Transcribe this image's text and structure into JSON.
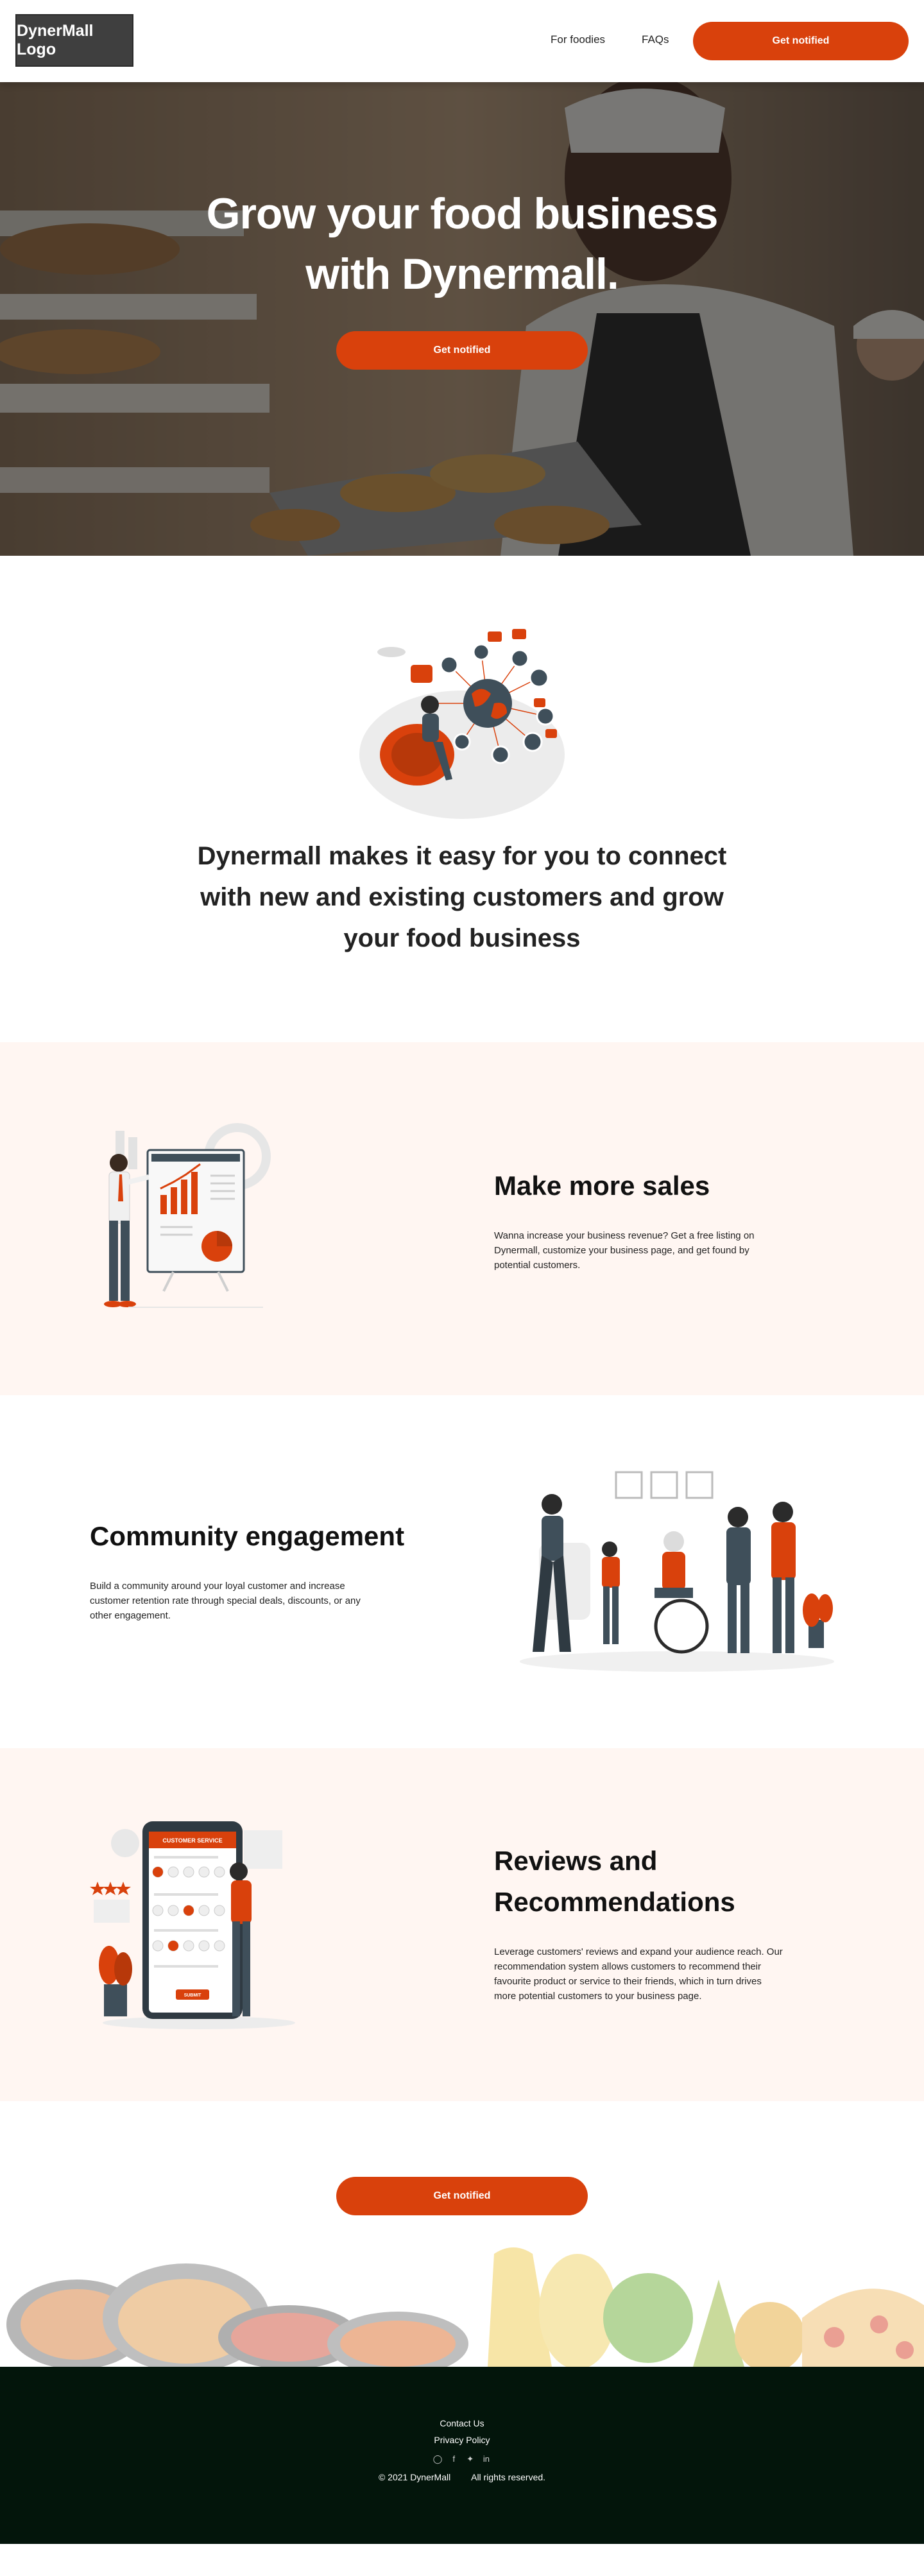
{
  "nav": {
    "logo": "DynerMall Logo",
    "links": [
      "For foodies",
      "FAQs"
    ],
    "cta": "Get notified"
  },
  "hero": {
    "title_line1": "Grow your food business",
    "title_line2": "with Dynermall.",
    "cta": "Get notified"
  },
  "intro": {
    "text": "Dynermall makes it easy for you to connect with new and existing customers and grow your food business"
  },
  "features": [
    {
      "title": "Make more sales",
      "body": "Wanna increase your business revenue? Get a free listing on Dynermall, customize your business page, and get found by potential customers."
    },
    {
      "title": "Community engagement",
      "body": "Build a community around your loyal customer and increase customer retention rate through special deals, discounts, or any other engagement."
    },
    {
      "title": "Reviews and Recommendations",
      "body": "Leverage customers' reviews and expand your audience reach. Our recommendation system allows customers to recommend their favourite product or service to their friends, which in turn drives more potential customers to your business page."
    }
  ],
  "phone_mock": {
    "header": "CUSTOMER SERVICE",
    "submit": "SUBMIT"
  },
  "cta": {
    "label": "Get notified"
  },
  "footer": {
    "contact": "Contact Us",
    "privacy": "Privacy Policy",
    "socials": [
      "instagram-icon",
      "facebook-icon",
      "twitter-icon",
      "linkedin-icon"
    ],
    "copyright": "© 2021 DynerMall",
    "rights": "All rights reserved."
  },
  "colors": {
    "accent": "#d9410c",
    "tint": "#fff6f2",
    "footer_bg": "#03150b"
  }
}
